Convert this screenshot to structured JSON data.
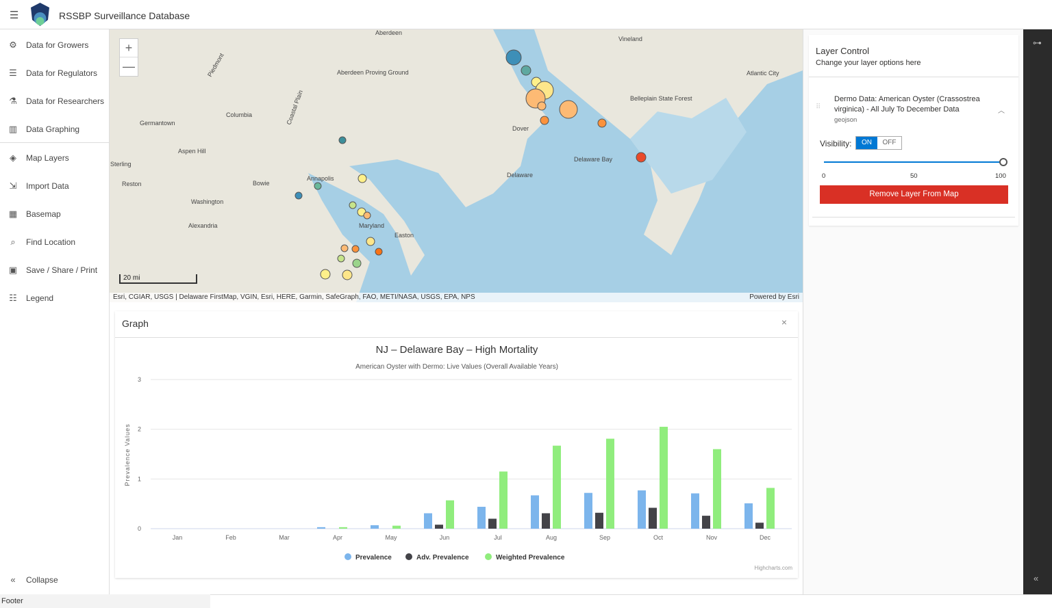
{
  "header": {
    "title": "RSSBP Surveillance Database",
    "menu_icon": "hamburger-icon"
  },
  "sidebar": {
    "items": [
      {
        "label": "Data for Growers",
        "icon": "puzzle-icon"
      },
      {
        "label": "Data for Regulators",
        "icon": "list-icon"
      },
      {
        "label": "Data for Researchers",
        "icon": "flask-icon"
      },
      {
        "label": "Data Graphing",
        "icon": "bar-chart-icon"
      },
      {
        "label": "Map Layers",
        "icon": "layers-icon"
      },
      {
        "label": "Import Data",
        "icon": "import-icon"
      },
      {
        "label": "Basemap",
        "icon": "grid-icon"
      },
      {
        "label": "Find Location",
        "icon": "search-icon"
      },
      {
        "label": "Save / Share / Print",
        "icon": "save-icon"
      },
      {
        "label": "Legend",
        "icon": "legend-icon"
      }
    ],
    "collapse": "Collapse"
  },
  "map": {
    "labels": [
      "Aberdeen",
      "Vineland",
      "Atlantic City",
      "Aberdeen Proving Ground",
      "Columbia",
      "Germantown",
      "Dover",
      "Belleplain State Forest",
      "Aspen Hill",
      "Sterling",
      "Reston",
      "Bowie",
      "Annapolis",
      "Washington",
      "Delaware",
      "Delaware Bay",
      "Alexandria",
      "Maryland",
      "Easton",
      "Piedmont",
      "Coastal Plain"
    ],
    "scale": "20 mi",
    "attribution": "Esri, CGIAR, USGS | Delaware FirstMap, VGIN, Esri, HERE, Garmin, SafeGraph, FAO, METI/NASA, USGS, EPA, NPS",
    "powered_by": "Powered by Esri",
    "zoom_in": "+",
    "zoom_out": "—"
  },
  "graph": {
    "panel_title": "Graph",
    "close": "×"
  },
  "chart_data": {
    "type": "bar",
    "title": "NJ – Delaware Bay – High Mortality",
    "subtitle": "American Oyster with Dermo: Live Values (Overall Available Years)",
    "ylabel": "Prevalence Values",
    "xlabel": "",
    "ylim": [
      0,
      3
    ],
    "yticks": [
      0,
      1,
      2,
      3
    ],
    "grid": true,
    "legend_position": "bottom",
    "credit": "Highcharts.com",
    "categories": [
      "Jan",
      "Feb",
      "Mar",
      "Apr",
      "May",
      "Jun",
      "Jul",
      "Aug",
      "Sep",
      "Oct",
      "Nov",
      "Dec"
    ],
    "series": [
      {
        "name": "Prevalence",
        "color": "#7cb5ec",
        "values": [
          0,
          0,
          0,
          0.03,
          0.07,
          0.31,
          0.44,
          0.67,
          0.72,
          0.77,
          0.71,
          0.51
        ]
      },
      {
        "name": "Adv. Prevalence",
        "color": "#434348",
        "values": [
          0,
          0,
          0,
          0,
          0,
          0.08,
          0.2,
          0.31,
          0.32,
          0.42,
          0.26,
          0.12
        ]
      },
      {
        "name": "Weighted Prevalence",
        "color": "#90ed7d",
        "values": [
          0,
          0,
          0,
          0.03,
          0.06,
          0.57,
          1.15,
          1.67,
          1.81,
          2.05,
          1.6,
          0.82
        ]
      }
    ]
  },
  "layer_control": {
    "title": "Layer Control",
    "subtitle": "Change your layer options here",
    "layer_name": "Dermo Data: American Oyster (Crassostrea virginica) - All July To December Data",
    "layer_type": "geojson",
    "visibility_label": "Visibility:",
    "on": "ON",
    "off": "OFF",
    "opacity": 100,
    "slider_ticks": [
      "0",
      "50",
      "100"
    ],
    "remove_button": "Remove Layer From Map",
    "accent": "#0078d4",
    "danger": "#d93025"
  },
  "footer": "Footer"
}
